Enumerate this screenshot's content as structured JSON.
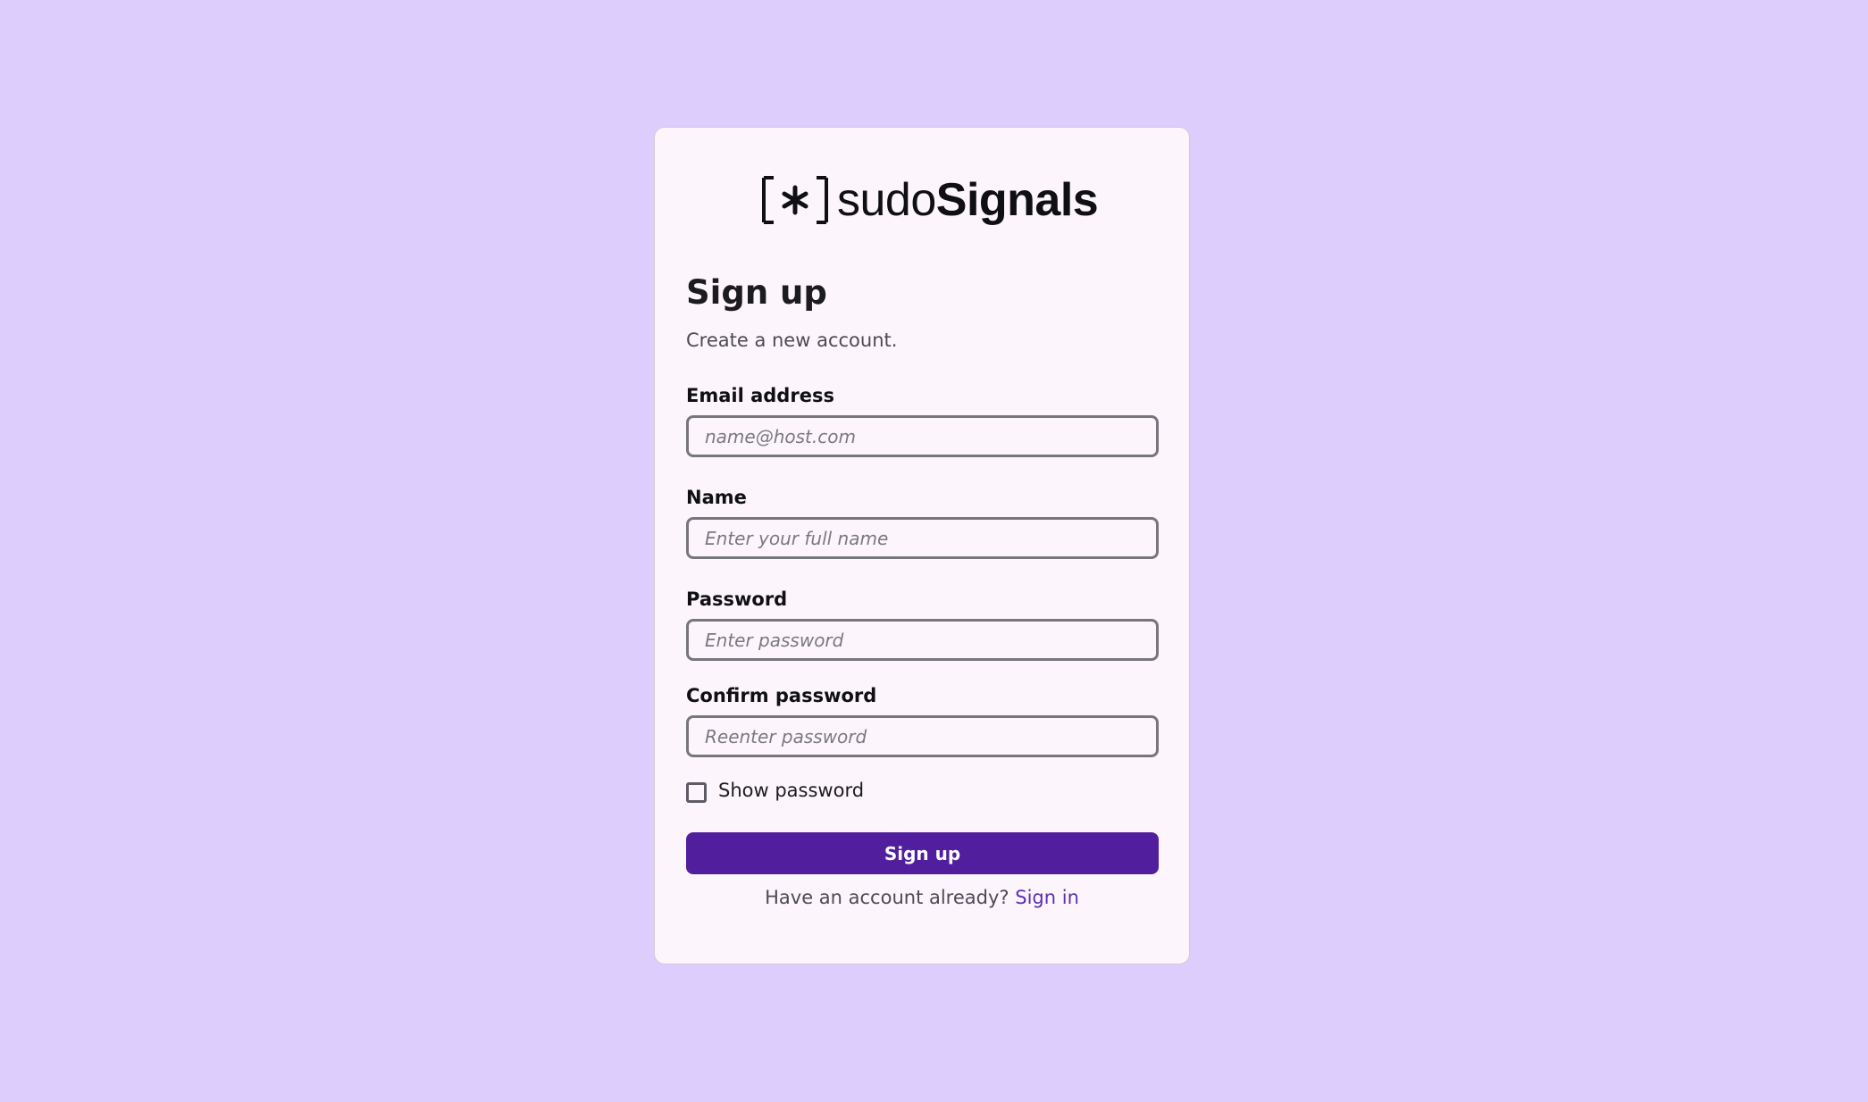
{
  "brand": {
    "name_light": "sudo",
    "name_bold": "Signals",
    "mark_icon": "bracket-asterisk-logo"
  },
  "form": {
    "title": "Sign up",
    "subtitle": "Create a new account.",
    "email": {
      "label": "Email address",
      "placeholder": "name@host.com",
      "value": ""
    },
    "name": {
      "label": "Name",
      "placeholder": "Enter your full name",
      "value": ""
    },
    "password": {
      "label": "Password",
      "placeholder": "Enter password",
      "value": ""
    },
    "confirm_password": {
      "label": "Confirm password",
      "placeholder": "Reenter password",
      "value": ""
    },
    "show_password": {
      "label": "Show password",
      "checked": false
    },
    "submit_label": "Sign up",
    "footer_text": "Have an account already?",
    "footer_link": "Sign in"
  },
  "colors": {
    "page_background": "#dccdfd",
    "card_background": "#fcf6fc",
    "primary": "#511e9e",
    "link": "#5d2eb0"
  }
}
